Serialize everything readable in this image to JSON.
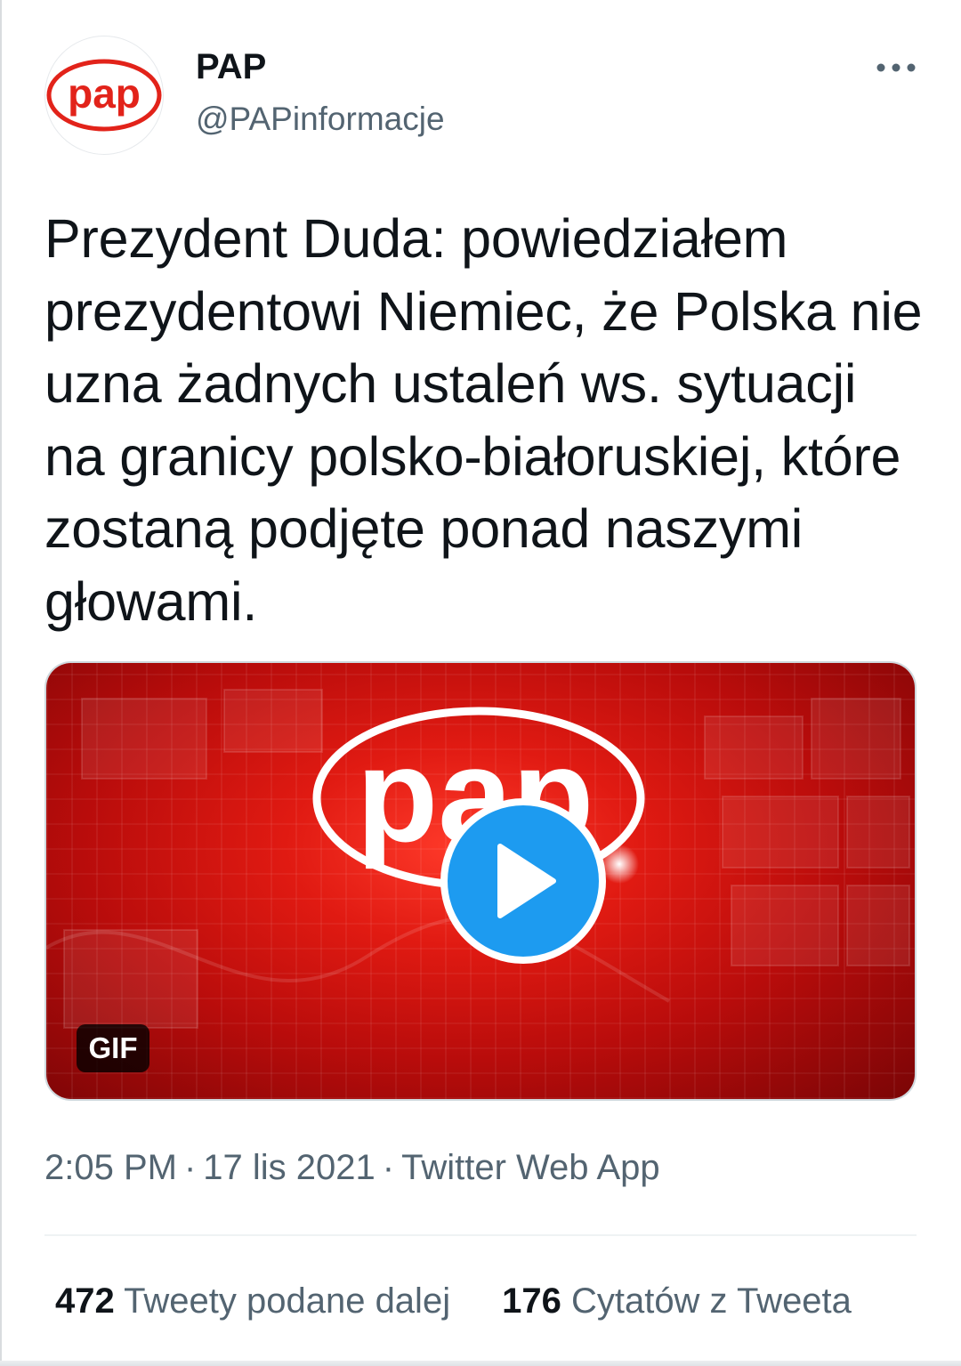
{
  "tweet": {
    "author": {
      "display_name": "PAP",
      "handle": "@PAPinformacje",
      "avatar_text": "pap",
      "avatar_icon": "pap-logo-avatar"
    },
    "more_icon": "more-horizontal-icon",
    "text": "Prezydent Duda: powiedziałem prezydentowi Niemiec, że Polska nie uzna żadnych ustaleń ws. sytuacji na granicy polsko-białoruskiej, które zostaną podjęte ponad naszymi głowami.",
    "media": {
      "logo_text": "pap",
      "badge": "GIF",
      "play_icon": "play-icon"
    },
    "meta": {
      "time": "2:05 PM",
      "date": "17 lis 2021",
      "source": "Twitter Web App",
      "separator": "·"
    },
    "stats": [
      {
        "count": "472",
        "label": "Tweety podane dalej"
      },
      {
        "count": "176",
        "label": "Cytatów z Tweeta"
      }
    ]
  },
  "colors": {
    "accent": "#1d9bf0",
    "brand_red": "#e2231a",
    "text_primary": "#0f1419",
    "text_secondary": "#536471"
  }
}
